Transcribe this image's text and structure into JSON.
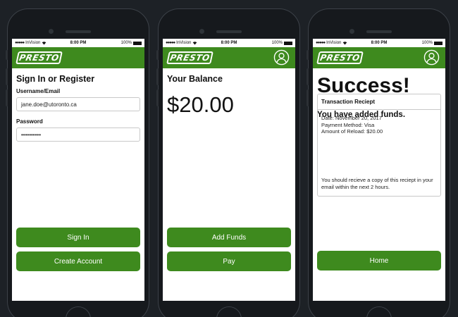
{
  "statusbar": {
    "carrier": "InVision",
    "time": "8:00 PM",
    "battery": "100%"
  },
  "brand": {
    "logo_text": "PRESTO",
    "accent_color": "#3e8a1e"
  },
  "screen1": {
    "title": "Sign In or Register",
    "username_label": "Username/Email",
    "username_value": "jane.doe@utoronto.ca",
    "password_label": "Password",
    "password_value": "••••••••••",
    "sign_in_label": "Sign In",
    "create_account_label": "Create Account"
  },
  "screen2": {
    "title": "Your Balance",
    "balance": "$20.00",
    "add_funds_label": "Add Funds",
    "pay_label": "Pay"
  },
  "screen3": {
    "title": "Success!",
    "subtitle": "You have added funds.",
    "receipt": {
      "heading": "Transaction Reciept",
      "date": "Date: November 20, 2017",
      "method": "Payment Method: Visa",
      "amount": "Amount of Reload: $20.00",
      "note": "You should recieve a copy of this reciept in your email within the next 2 hours."
    },
    "home_label": "Home"
  },
  "icons": {
    "profile": "user-circle-icon",
    "wifi": "wifi-icon",
    "signal": "signal-dots-icon",
    "battery": "battery-icon"
  }
}
